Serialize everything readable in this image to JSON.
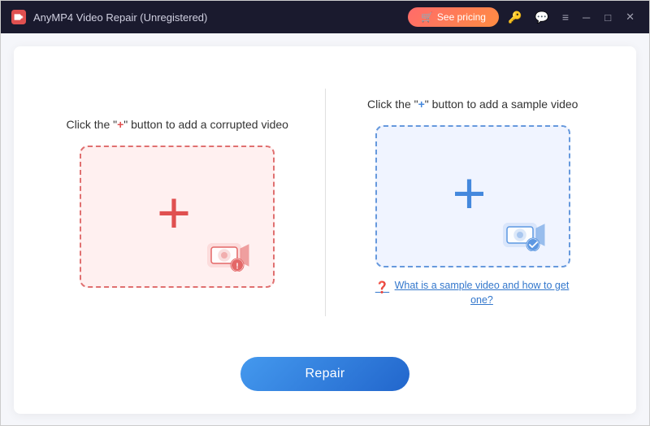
{
  "titlebar": {
    "title": "AnyMP4 Video Repair (Unregistered)",
    "pricing_label": "See pricing",
    "icons": {
      "key": "🔑",
      "chat": "💬",
      "menu": "≡",
      "minimize": "─",
      "maximize": "□",
      "close": "✕"
    }
  },
  "left_panel": {
    "title_prefix": "Click the \"",
    "title_plus": "+",
    "title_suffix": "\" button to add a corrupted video",
    "drop_zone_type": "red"
  },
  "right_panel": {
    "title_prefix": "Click the \"",
    "title_plus": "+",
    "title_suffix": "\" button to add a sample video",
    "drop_zone_type": "blue",
    "help_text": "What is a sample video and how to get one?"
  },
  "repair_button": {
    "label": "Repair"
  }
}
